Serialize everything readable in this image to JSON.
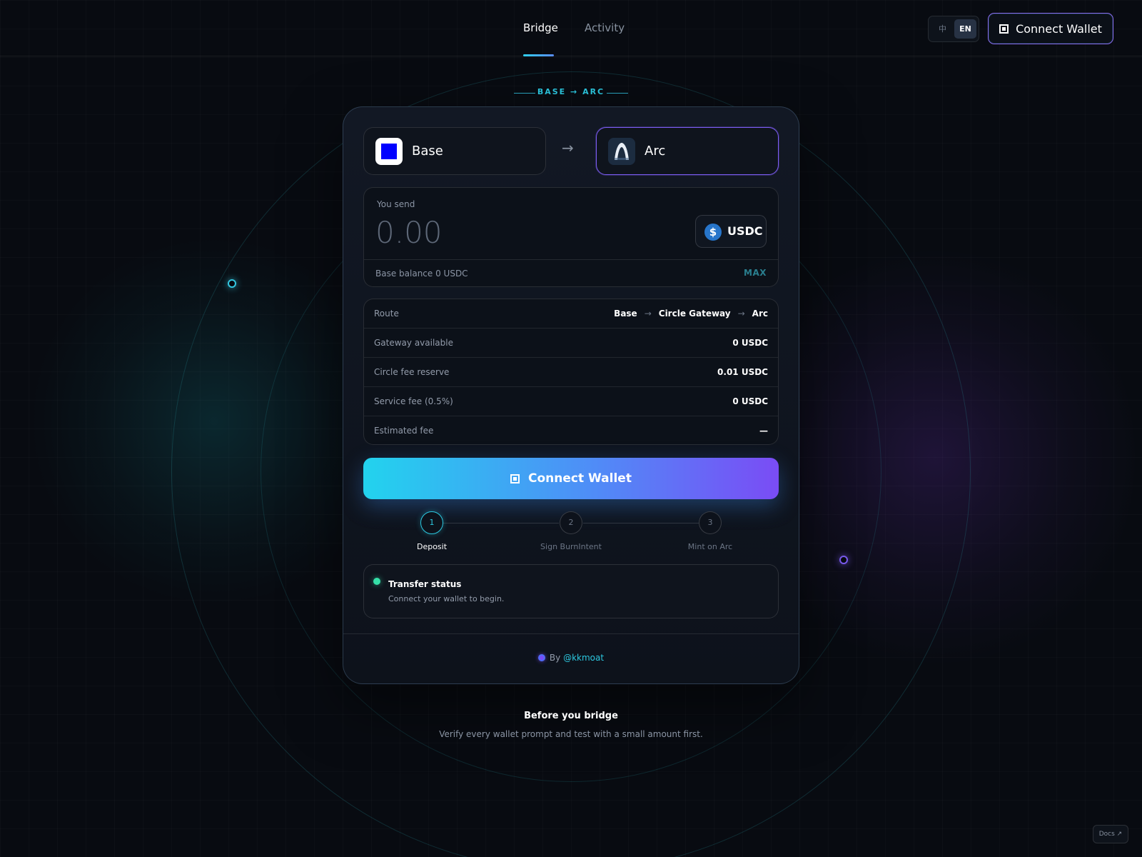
{
  "nav": {
    "tabs": [
      {
        "label": "Bridge",
        "active": true
      },
      {
        "label": "Activity",
        "active": false
      }
    ]
  },
  "language": {
    "options": [
      "中",
      "EN"
    ],
    "selected": "EN"
  },
  "header": {
    "connect_label": "Connect Wallet"
  },
  "route_banner": "BASE → ARC",
  "chains": {
    "source": {
      "name": "Base",
      "logo": "base-logo"
    },
    "destination": {
      "name": "Arc",
      "logo": "arc-logo"
    },
    "arrow": "→"
  },
  "send": {
    "label": "You send",
    "amount": "0.00",
    "token": "USDC",
    "token_icon": "dollar-icon",
    "balance": "Base balance 0 USDC",
    "max_label": "MAX"
  },
  "details": {
    "route": {
      "label": "Route",
      "hops": [
        "Base",
        "Circle Gateway",
        "Arc"
      ]
    },
    "rows": [
      {
        "label": "Gateway available",
        "value": "0 USDC"
      },
      {
        "label": "Circle fee reserve",
        "value": "0.01 USDC"
      },
      {
        "label": "Service fee (0.5%)",
        "value": "0 USDC"
      },
      {
        "label": "Estimated fee",
        "value": "—"
      }
    ]
  },
  "cta_label": "Connect Wallet",
  "steps": [
    {
      "number": "1",
      "label": "Deposit",
      "active": true
    },
    {
      "number": "2",
      "label": "Sign BurnIntent",
      "active": false
    },
    {
      "number": "3",
      "label": "Mint on Arc",
      "active": false
    }
  ],
  "status": {
    "title": "Transfer status",
    "description": "Connect your wallet to begin."
  },
  "footer": {
    "by_prefix": "By",
    "handle": "@kkmoat"
  },
  "notice": {
    "title": "Before you bridge",
    "description": "Verify every wallet prompt and test with a small amount first."
  },
  "docs_label": "Docs ↗",
  "colors": {
    "accent_cyan": "#22d3ee",
    "accent_violet": "#7a4cf5",
    "status_ok": "#35e0a8",
    "background": "#080b11"
  }
}
